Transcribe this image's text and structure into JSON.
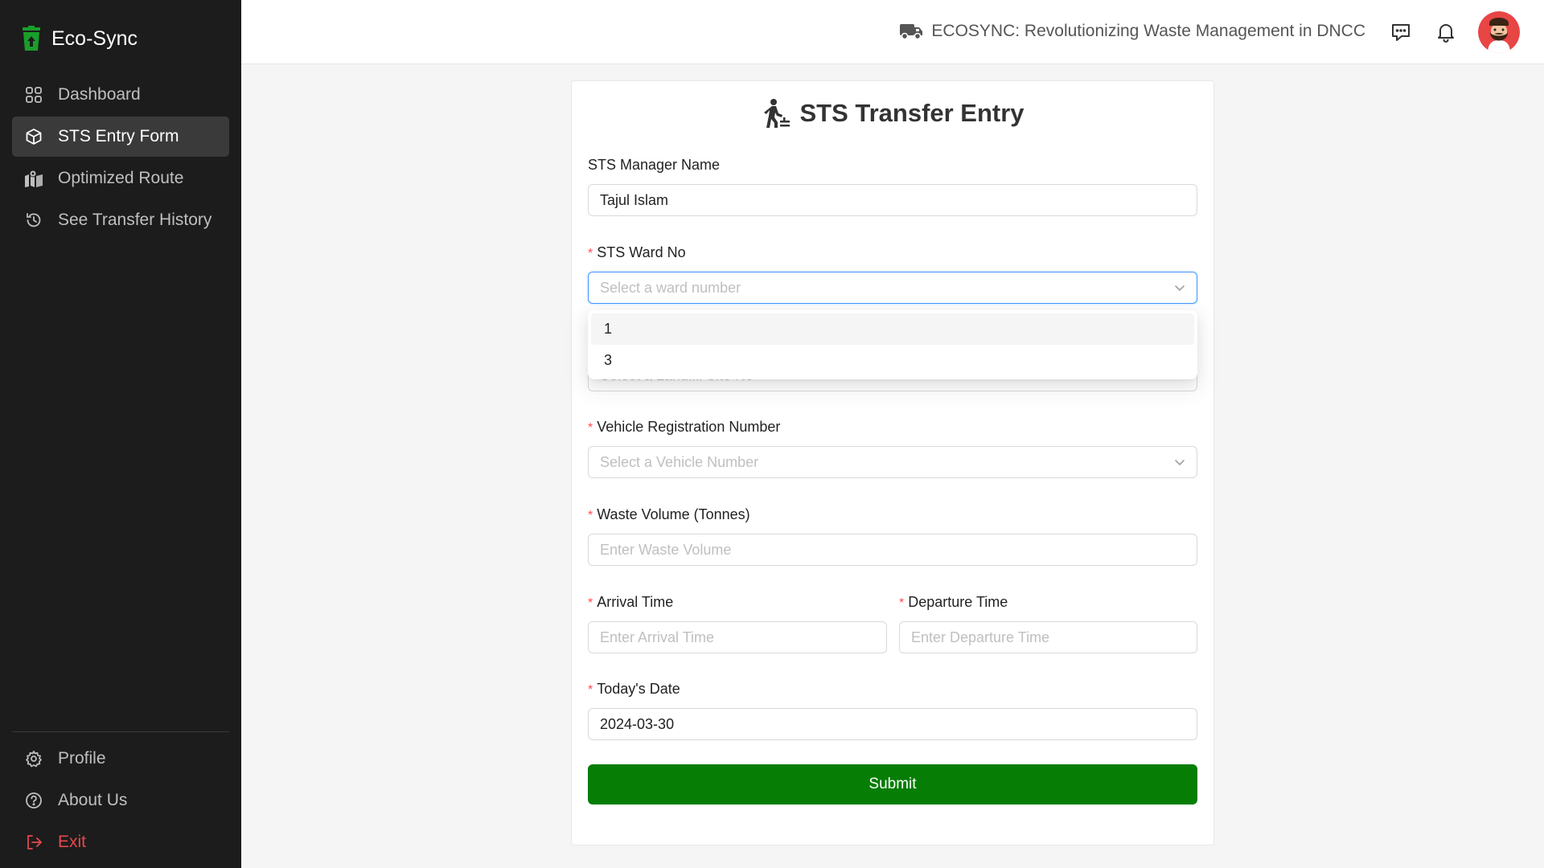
{
  "brand": {
    "name": "Eco-Sync",
    "icon": "trash-bin-icon",
    "accent": "#1a9e2a"
  },
  "sidebar": {
    "items": [
      {
        "label": "Dashboard",
        "icon": "grid-icon"
      },
      {
        "label": "STS Entry Form",
        "icon": "cube-icon",
        "active": true
      },
      {
        "label": "Optimized Route",
        "icon": "map-icon"
      },
      {
        "label": "See Transfer History",
        "icon": "history-icon"
      }
    ],
    "bottom": [
      {
        "label": "Profile",
        "icon": "gear-icon"
      },
      {
        "label": "About Us",
        "icon": "question-circle-icon"
      },
      {
        "label": "Exit",
        "icon": "logout-icon"
      }
    ]
  },
  "header": {
    "title": "ECOSYNC: Revolutionizing Waste Management in DNCC",
    "icons": [
      "truck-icon",
      "message-icon",
      "bell-icon",
      "avatar"
    ]
  },
  "form": {
    "title": "STS Transfer Entry",
    "manager": {
      "label": "STS Manager Name",
      "value": "Tajul Islam"
    },
    "ward": {
      "label": "STS Ward No",
      "placeholder": "Select a ward number",
      "options": [
        "1",
        "3"
      ]
    },
    "landfill": {
      "placeholder": "Select a Landfill Site No"
    },
    "vehicle": {
      "label": "Vehicle Registration Number",
      "placeholder": "Select a Vehicle Number"
    },
    "waste": {
      "label": "Waste Volume (Tonnes)",
      "placeholder": "Enter Waste Volume"
    },
    "arrival": {
      "label": "Arrival Time",
      "placeholder": "Enter Arrival Time"
    },
    "departure": {
      "label": "Departure Time",
      "placeholder": "Enter Departure Time"
    },
    "date": {
      "label": "Today's Date",
      "value": "2024-03-30"
    },
    "submit_label": "Submit",
    "submit_color": "#067e06"
  }
}
